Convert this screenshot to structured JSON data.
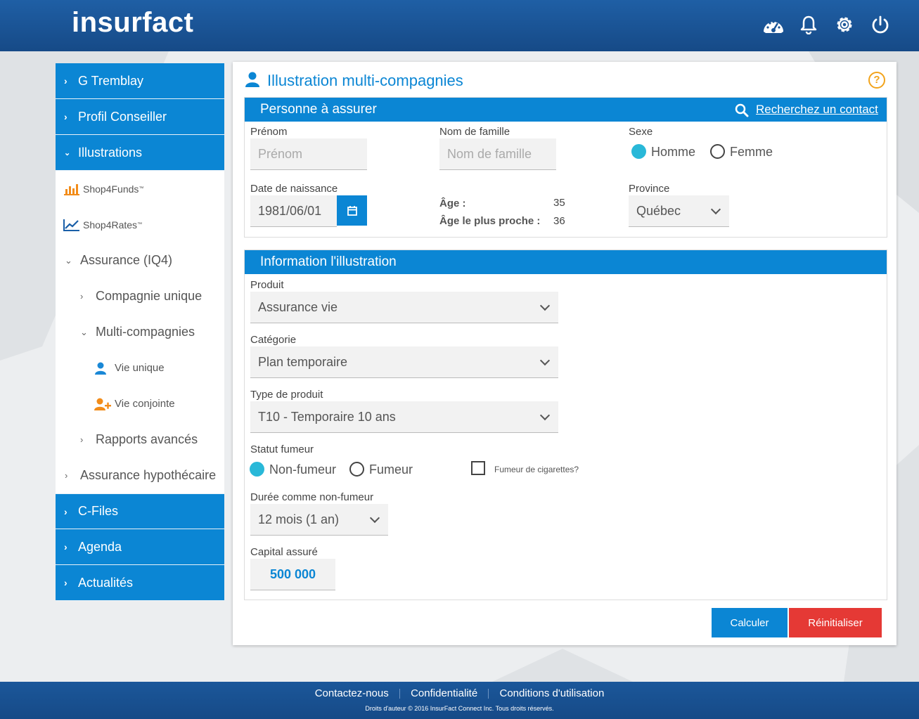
{
  "header": {
    "logo": "insurfact"
  },
  "sidebar": {
    "top_items": [
      {
        "label": "G Tremblay"
      },
      {
        "label": "Profil Conseiller"
      },
      {
        "label": "Illustrations"
      }
    ],
    "sub_items": {
      "shop4funds": "Shop4Funds",
      "shop4funds_tm": "™",
      "shop4rates": "Shop4Rates",
      "shop4rates_tm": "™",
      "assurance": "Assurance (IQ4)",
      "compagnie_unique": "Compagnie unique",
      "multi_compagnies": "Multi-compagnies",
      "vie_unique": "Vie unique",
      "vie_conjointe": "Vie conjointe",
      "rapports": "Rapports avancés",
      "hypothecaire": "Assurance hypothécaire"
    },
    "bottom_items": [
      {
        "label": "C-Files"
      },
      {
        "label": "Agenda"
      },
      {
        "label": "Actualités"
      }
    ]
  },
  "panel": {
    "title": "Illustration multi-compagnies",
    "help": "?"
  },
  "personne": {
    "heading": "Personne à assurer",
    "search_link": "Recherchez un contact",
    "prenom_label": "Prénom",
    "prenom_placeholder": "Prénom",
    "nom_label": "Nom de famille",
    "nom_placeholder": "Nom de famille",
    "sexe_label": "Sexe",
    "sexe_options": [
      "Homme",
      "Femme"
    ],
    "sexe_selected": "Homme",
    "dob_label": "Date de naissance",
    "dob_value": "1981/06/01",
    "age_label": "Âge :",
    "age_value": "35",
    "age_proche_label": "Âge le plus proche :",
    "age_proche_value": "36",
    "province_label": "Province",
    "province_value": "Québec"
  },
  "illustration": {
    "heading": "Information l'illustration",
    "produit_label": "Produit",
    "produit_value": "Assurance vie",
    "categorie_label": "Catégorie",
    "categorie_value": "Plan temporaire",
    "type_label": "Type de produit",
    "type_value": "T10 - Temporaire 10 ans",
    "fumeur_label": "Statut fumeur",
    "fumeur_options": [
      "Non-fumeur",
      "Fumeur"
    ],
    "fumeur_selected": "Non-fumeur",
    "cigarettes_label": "Fumeur de cigarettes?",
    "duree_label": "Durée comme non-fumeur",
    "duree_value": "12 mois (1 an)",
    "capital_label": "Capital assuré",
    "capital_value": "500 000"
  },
  "buttons": {
    "calculer": "Calculer",
    "reinitialiser": "Réinitialiser"
  },
  "footer": {
    "links": [
      "Contactez-nous",
      "Confidentialité",
      "Conditions d'utilisation"
    ],
    "copyright": "Droits d'auteur © 2016 InsurFact Connect Inc. Tous droits réservés."
  },
  "colors": {
    "primary": "#0b86d4",
    "header": "#1a5598",
    "danger": "#e53935",
    "radio_on": "#29b8d8",
    "help": "#f2a31b"
  }
}
